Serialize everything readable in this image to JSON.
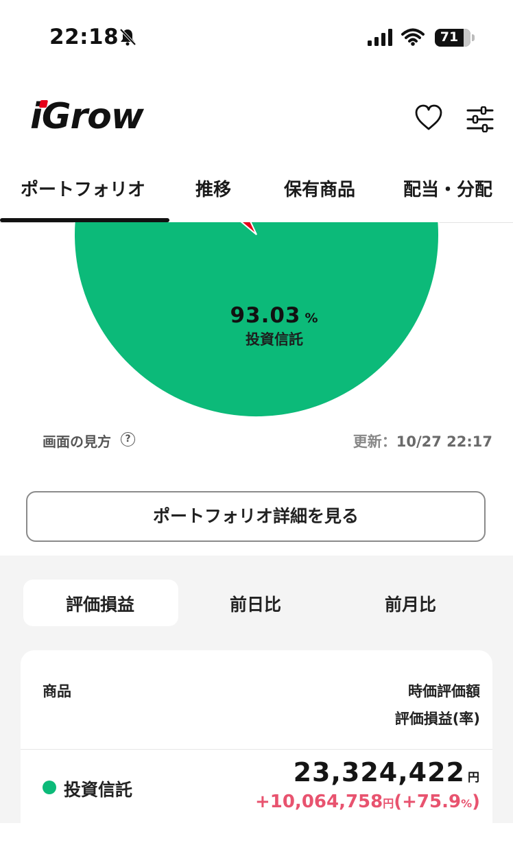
{
  "status_bar": {
    "time": "22:18",
    "battery": "71"
  },
  "header": {
    "logo": "iGrow"
  },
  "tabs": [
    "ポートフォリオ",
    "推移",
    "保有商品",
    "配当・分配"
  ],
  "chart_data": {
    "type": "pie",
    "slices": [
      {
        "name": "投資信託",
        "value": 93.03,
        "color": "#0cba79"
      },
      {
        "name": "",
        "value": 6.97,
        "color": "#e6001a"
      }
    ],
    "center_percent": "93.03",
    "center_percent_unit": "%",
    "center_label": "投資信託"
  },
  "help": {
    "label": "画面の見方",
    "icon": "?"
  },
  "updated": {
    "label": "更新：",
    "value": "10/27 22:17"
  },
  "detail_button": "ポートフォリオ詳細を見る",
  "segments": [
    "評価損益",
    "前日比",
    "前月比"
  ],
  "table": {
    "col_product": "商品",
    "col_value": "時価評価額",
    "col_gain": "評価損益(率)",
    "rows": [
      {
        "name": "投資信託",
        "value": "23,324,422",
        "value_unit": "円",
        "gain": "+10,064,758",
        "gain_unit": "円",
        "rate": "(+75.9",
        "rate_unit": "%",
        "rate_close": ")",
        "color": "#0cba79"
      }
    ]
  }
}
